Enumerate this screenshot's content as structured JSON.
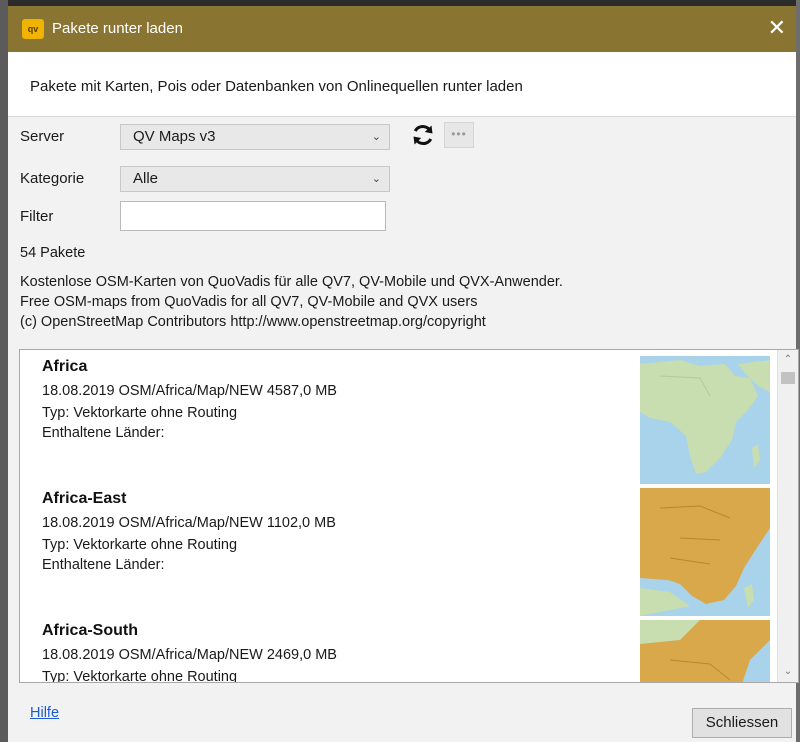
{
  "window": {
    "title": "Pakete runter laden",
    "app_icon_text": "qv",
    "close_glyph": "✕"
  },
  "description": "Pakete mit Karten, Pois oder Datenbanken von Onlinequellen runter laden",
  "form": {
    "server_label": "Server",
    "server_value": "QV Maps v3",
    "kategorie_label": "Kategorie",
    "kategorie_value": "Alle",
    "filter_label": "Filter",
    "filter_value": "",
    "more_label": "•••"
  },
  "package_count": "54 Pakete",
  "info_lines": [
    "Kostenlose OSM-Karten von QuoVadis für alle QV7, QV-Mobile und QVX-Anwender.",
    "Free OSM-maps from QuoVadis for all QV7, QV-Mobile and QVX users",
    "(c) OpenStreetMap Contributors http://www.openstreetmap.org/copyright"
  ],
  "packages": [
    {
      "name": "Africa",
      "meta": "18.08.2019  OSM/Africa/Map/NEW  4587,0 MB",
      "type": "Typ: Vektorkarte ohne Routing",
      "countries": "Enthaltene Länder:"
    },
    {
      "name": "Africa-East",
      "meta": "18.08.2019  OSM/Africa/Map/NEW  1102,0 MB",
      "type": "Typ: Vektorkarte ohne Routing",
      "countries": "Enthaltene Länder:"
    },
    {
      "name": "Africa-South",
      "meta": "18.08.2019  OSM/Africa/Map/NEW  2469,0 MB",
      "type": "Typ: Vektorkarte ohne Routing",
      "countries": ""
    }
  ],
  "footer": {
    "help_label": "Hilfe",
    "close_label": "Schliessen"
  },
  "colors": {
    "titlebar": "#8a7432",
    "link": "#1a5bd6",
    "map_water": "#a9d3ea",
    "map_land": "#c8ddb0",
    "map_highlight": "#d9a84a"
  },
  "icons": {
    "refresh": "refresh-icon",
    "chevron": "chevron-down-icon",
    "scroll_up": "scroll-up-icon",
    "scroll_down": "scroll-down-icon"
  }
}
